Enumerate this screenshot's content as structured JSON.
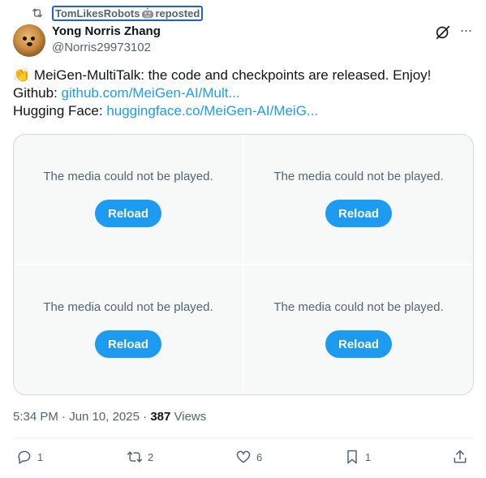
{
  "repost": {
    "user": "TomLikesRobots",
    "emoji": "🤖",
    "label": "reposted"
  },
  "author": {
    "name": "Yong Norris Zhang",
    "handle": "@Norris29973102"
  },
  "tweet": {
    "emoji": "👏",
    "line1": "MeiGen-MultiTalk: the code and checkpoints are released. Enjoy!",
    "github_label": "Github:",
    "github_link": "github.com/MeiGen-AI/Mult...",
    "hf_label": "Hugging Face:",
    "hf_link": "huggingface.co/MeiGen-AI/MeiG..."
  },
  "media": [
    {
      "message": "The media could not be played.",
      "button": "Reload"
    },
    {
      "message": "The media could not be played.",
      "button": "Reload"
    },
    {
      "message": "The media could not be played.",
      "button": "Reload"
    },
    {
      "message": "The media could not be played.",
      "button": "Reload"
    }
  ],
  "meta": {
    "time": "5:34 PM",
    "date": "Jun 10, 2025",
    "views_count": "387",
    "views_label": "Views"
  },
  "actions": {
    "replies": "1",
    "reposts": "2",
    "likes": "6",
    "bookmarks": "1"
  },
  "colors": {
    "accent": "#1d9bf0",
    "secondary_text": "#536471",
    "media_bg": "#f7f9f9",
    "focus_outline": "#1d63c9"
  },
  "icons": [
    "repost-icon",
    "grok-icon",
    "more-icon",
    "reply-icon",
    "like-icon",
    "bookmark-icon",
    "share-icon"
  ]
}
